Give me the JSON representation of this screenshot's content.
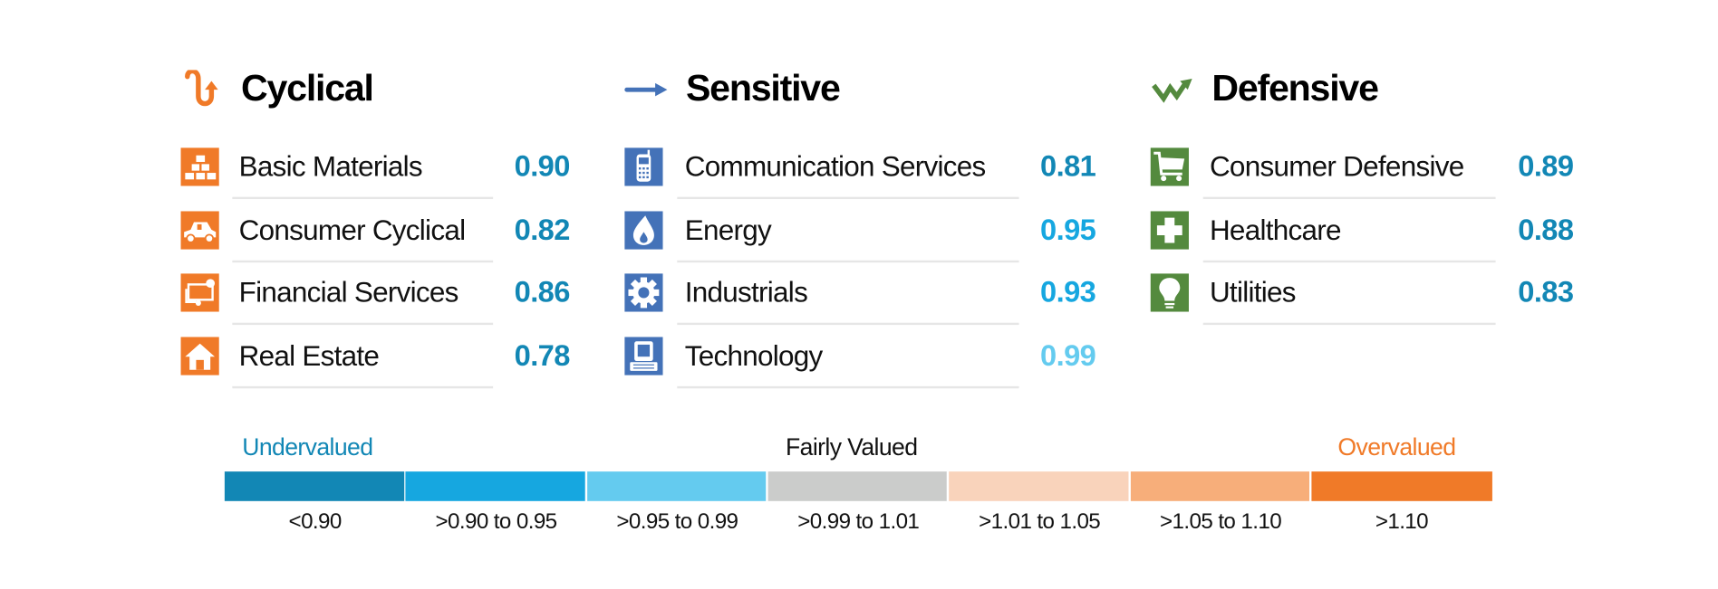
{
  "chart_data": {
    "type": "table",
    "groups": [
      {
        "title": "Cyclical",
        "icon": "cyclical-arrow-icon",
        "color": "#f07a28",
        "sectors": [
          {
            "name": "Basic Materials",
            "value": 0.9,
            "icon": "gold-bars-icon"
          },
          {
            "name": "Consumer Cyclical",
            "value": 0.82,
            "icon": "car-icon"
          },
          {
            "name": "Financial Services",
            "value": 0.86,
            "icon": "money-icon"
          },
          {
            "name": "Real Estate",
            "value": 0.78,
            "icon": "house-icon"
          }
        ]
      },
      {
        "title": "Sensitive",
        "icon": "right-arrow-icon",
        "color": "#4472b8",
        "sectors": [
          {
            "name": "Communication Services",
            "value": 0.81,
            "icon": "phone-icon"
          },
          {
            "name": "Energy",
            "value": 0.95,
            "icon": "flame-icon"
          },
          {
            "name": "Industrials",
            "value": 0.93,
            "icon": "gear-icon"
          },
          {
            "name": "Technology",
            "value": 0.99,
            "icon": "computer-icon"
          }
        ]
      },
      {
        "title": "Defensive",
        "icon": "zigzag-up-arrow-icon",
        "color": "#548a3e",
        "sectors": [
          {
            "name": "Consumer Defensive",
            "value": 0.89,
            "icon": "cart-icon"
          },
          {
            "name": "Healthcare",
            "value": 0.88,
            "icon": "cross-icon"
          },
          {
            "name": "Utilities",
            "value": 0.83,
            "icon": "lightbulb-icon"
          }
        ]
      }
    ],
    "legend": {
      "undervalued": "Undervalued",
      "fairly_valued": "Fairly Valued",
      "overvalued": "Overvalued",
      "undervalued_color": "#1287b5",
      "overvalued_color": "#f07a28",
      "bins": [
        {
          "label": "<0.90",
          "max": 0.9,
          "color": "#1287b5"
        },
        {
          "label": ">0.90 to 0.95",
          "max": 0.95,
          "color": "#16a7e0"
        },
        {
          "label": ">0.95 to 0.99",
          "max": 0.99,
          "color": "#64cbef"
        },
        {
          "label": ">0.99 to 1.01",
          "max": 1.01,
          "color": "#cbcccb"
        },
        {
          "label": ">1.01 to 1.05",
          "max": 1.05,
          "color": "#f9d3bb"
        },
        {
          "label": ">1.05 to 1.10",
          "max": 1.1,
          "color": "#f7ae7a"
        },
        {
          "label": ">1.10",
          "max": 99,
          "color": "#f07a28"
        }
      ]
    }
  }
}
